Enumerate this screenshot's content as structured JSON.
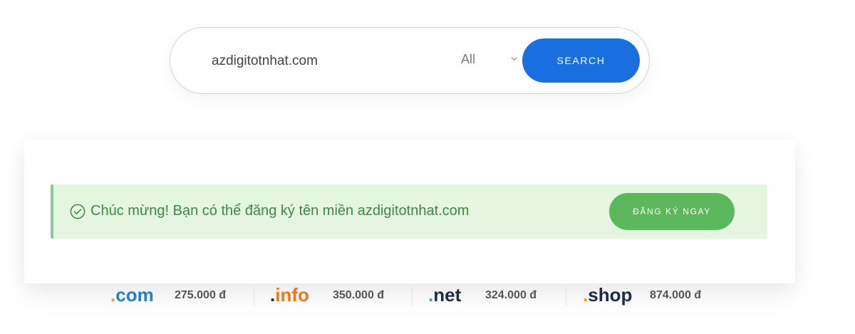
{
  "search": {
    "query": "azdigitotnhat.com",
    "tld_selected": "All",
    "button_label": "SEARCH"
  },
  "result": {
    "message": "Chúc mừng! Bạn có thể đăng ký tên miền azdigitotnhat.com",
    "register_label": "ĐĂNG KÝ NGAY"
  },
  "pricing": [
    {
      "dot": ".",
      "name": "com",
      "price": "275.000 đ",
      "dot_color": "#f39a1e",
      "name_color": "#1f7ed6"
    },
    {
      "dot": ".",
      "name": "info",
      "price": "350.000 đ",
      "dot_color": "#2a2a2a",
      "name_color": "#f0761e"
    },
    {
      "dot": ".",
      "name": "net",
      "price": "324.000 đ",
      "dot_color": "#3b9ae8",
      "name_color": "#1c2b4a"
    },
    {
      "dot": ".",
      "name": "shop",
      "price": "874.000 đ",
      "dot_color": "#f39a1e",
      "name_color": "#1c2b4a"
    }
  ],
  "colors": {
    "primary": "#1a6fe0",
    "success": "#5cb85c",
    "alert_bg": "#e4f6df",
    "alert_text": "#3a8a44"
  },
  "icons": {
    "select": "chevron-down-icon",
    "alert": "check-circle-icon"
  }
}
